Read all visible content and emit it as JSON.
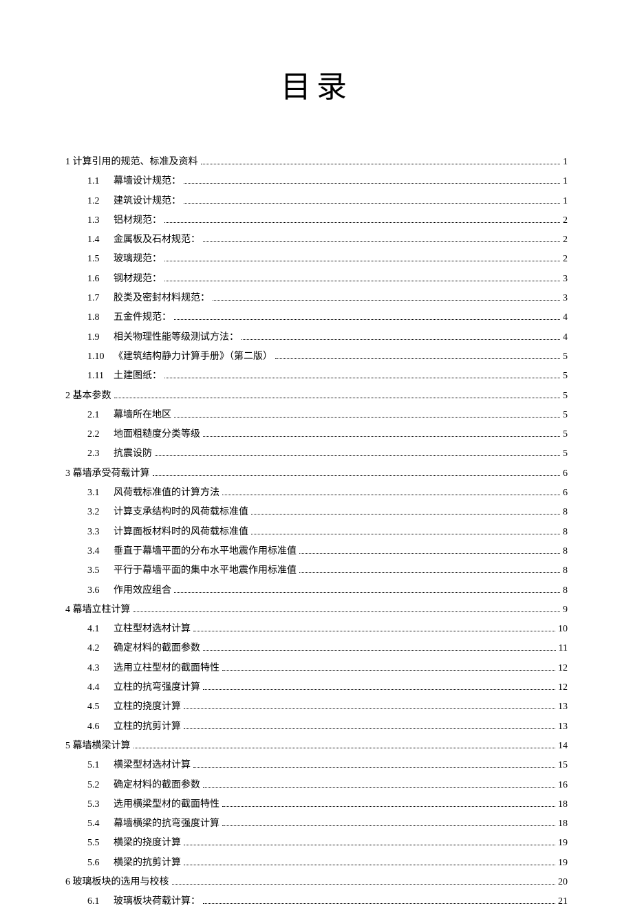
{
  "title": "目录",
  "entries": [
    {
      "level": 1,
      "num": "1",
      "text": "计算引用的规范、标准及资料",
      "page": "1"
    },
    {
      "level": 2,
      "num": "1.1",
      "text": "幕墙设计规范：",
      "page": "1"
    },
    {
      "level": 2,
      "num": "1.2",
      "text": "建筑设计规范：",
      "page": "1"
    },
    {
      "level": 2,
      "num": "1.3",
      "text": "铝材规范：",
      "page": "2"
    },
    {
      "level": 2,
      "num": "1.4",
      "text": "金属板及石材规范：",
      "page": "2"
    },
    {
      "level": 2,
      "num": "1.5",
      "text": "玻璃规范：",
      "page": "2"
    },
    {
      "level": 2,
      "num": "1.6",
      "text": "钢材规范：",
      "page": "3"
    },
    {
      "level": 2,
      "num": "1.7",
      "text": "胶类及密封材料规范：",
      "page": "3"
    },
    {
      "level": 2,
      "num": "1.8",
      "text": "五金件规范：",
      "page": "4"
    },
    {
      "level": 2,
      "num": "1.9",
      "text": "相关物理性能等级测试方法：",
      "page": "4"
    },
    {
      "level": 2,
      "num": "1.10",
      "text": "《建筑结构静力计算手册》（第二版）",
      "page": "5"
    },
    {
      "level": 2,
      "num": "1.11",
      "text": "土建图纸：",
      "page": "5"
    },
    {
      "level": 1,
      "num": "2",
      "text": "基本参数",
      "page": "5"
    },
    {
      "level": 2,
      "num": "2.1",
      "text": "幕墙所在地区",
      "page": "5"
    },
    {
      "level": 2,
      "num": "2.2",
      "text": "地面粗糙度分类等级",
      "page": "5"
    },
    {
      "level": 2,
      "num": "2.3",
      "text": "抗震设防",
      "page": "5"
    },
    {
      "level": 1,
      "num": "3",
      "text": "幕墙承受荷载计算",
      "page": "6"
    },
    {
      "level": 2,
      "num": "3.1",
      "text": "风荷载标准值的计算方法",
      "page": "6"
    },
    {
      "level": 2,
      "num": "3.2",
      "text": "计算支承结构时的风荷载标准值",
      "page": "8"
    },
    {
      "level": 2,
      "num": "3.3",
      "text": "计算面板材料时的风荷载标准值",
      "page": "8"
    },
    {
      "level": 2,
      "num": "3.4",
      "text": "垂直于幕墙平面的分布水平地震作用标准值",
      "page": "8"
    },
    {
      "level": 2,
      "num": "3.5",
      "text": "平行于幕墙平面的集中水平地震作用标准值",
      "page": "8"
    },
    {
      "level": 2,
      "num": "3.6",
      "text": "作用效应组合",
      "page": "8"
    },
    {
      "level": 1,
      "num": "4",
      "text": "幕墙立柱计算",
      "page": "9"
    },
    {
      "level": 2,
      "num": "4.1",
      "text": "立柱型材选材计算",
      "page": "10"
    },
    {
      "level": 2,
      "num": "4.2",
      "text": "确定材料的截面参数",
      "page": "11"
    },
    {
      "level": 2,
      "num": "4.3",
      "text": "选用立柱型材的截面特性",
      "page": "12"
    },
    {
      "level": 2,
      "num": "4.4",
      "text": "立柱的抗弯强度计算",
      "page": "12"
    },
    {
      "level": 2,
      "num": "4.5",
      "text": "立柱的挠度计算",
      "page": "13"
    },
    {
      "level": 2,
      "num": "4.6",
      "text": "立柱的抗剪计算",
      "page": "13"
    },
    {
      "level": 1,
      "num": "5",
      "text": "幕墙横梁计算",
      "page": "14"
    },
    {
      "level": 2,
      "num": "5.1",
      "text": "横梁型材选材计算",
      "page": "15"
    },
    {
      "level": 2,
      "num": "5.2",
      "text": "确定材料的截面参数",
      "page": "16"
    },
    {
      "level": 2,
      "num": "5.3",
      "text": "选用横梁型材的截面特性",
      "page": "18"
    },
    {
      "level": 2,
      "num": "5.4",
      "text": "幕墙横梁的抗弯强度计算",
      "page": "18"
    },
    {
      "level": 2,
      "num": "5.5",
      "text": "横梁的挠度计算",
      "page": "19"
    },
    {
      "level": 2,
      "num": "5.6",
      "text": "横梁的抗剪计算",
      "page": "19"
    },
    {
      "level": 1,
      "num": "6",
      "text": "玻璃板块的选用与校核",
      "page": "20"
    },
    {
      "level": 2,
      "num": "6.1",
      "text": "玻璃板块荷载计算：",
      "page": "21"
    }
  ]
}
